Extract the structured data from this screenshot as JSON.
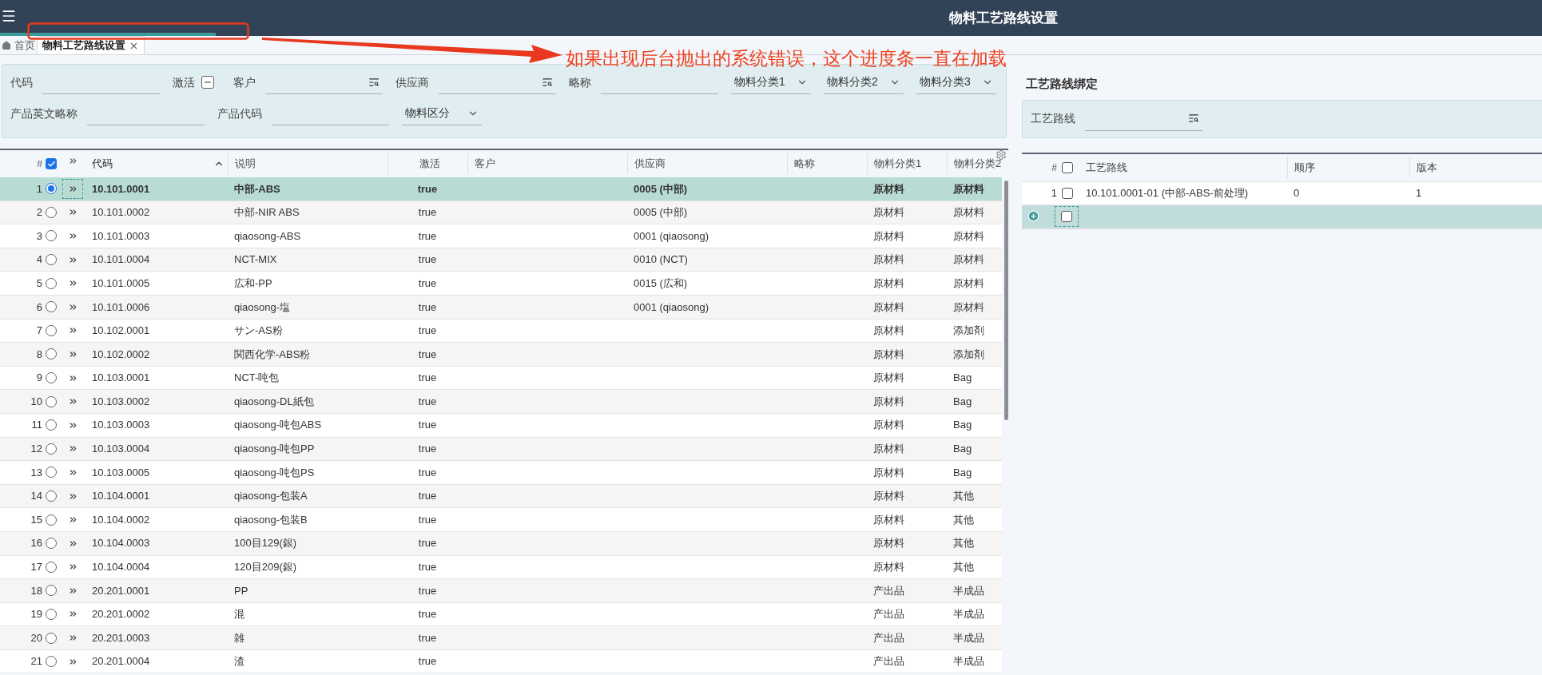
{
  "header": {
    "title": "物料工艺路线设置"
  },
  "progress": {
    "level": 0.14
  },
  "tabs": [
    {
      "label": "首页",
      "selected": false,
      "kind": "home"
    },
    {
      "label": "物料工艺路线设置",
      "selected": true,
      "kind": "closable"
    }
  ],
  "annotation": {
    "text": "如果出现后台抛出的系统错误，这个进度条一直在加载"
  },
  "filters": [
    [
      {
        "kind": "text",
        "label": "代码"
      },
      {
        "kind": "checkbox",
        "label": "激活",
        "indeterminate": true
      },
      {
        "kind": "lookup",
        "label": "客户"
      },
      {
        "kind": "lookup",
        "label": "供应商"
      },
      {
        "kind": "text",
        "label": "略称"
      },
      {
        "kind": "select",
        "label": "物料分类1"
      },
      {
        "kind": "select",
        "label": "物料分类2"
      },
      {
        "kind": "select",
        "label": "物料分类3"
      }
    ],
    [
      {
        "kind": "text",
        "label": "产品英文略称"
      },
      {
        "kind": "text",
        "label": "产品代码"
      },
      {
        "kind": "select",
        "label": "物料区分"
      }
    ]
  ],
  "table": {
    "number_heading": "#",
    "all_checked": true,
    "columns": [
      {
        "label": "代码",
        "sorted": true
      },
      {
        "label": "说明",
        "sorted": false
      },
      {
        "label": "激活",
        "sorted": false
      },
      {
        "label": "客户",
        "sorted": false
      },
      {
        "label": "供应商",
        "sorted": false
      },
      {
        "label": "略称",
        "sorted": false
      },
      {
        "label": "物料分类1",
        "sorted": false
      },
      {
        "label": "物料分类2",
        "sorted": false
      }
    ],
    "rows": [
      {
        "no": "1",
        "selected": true,
        "code": "10.101.0001",
        "description": "中部-ABS",
        "active": "true",
        "supplier": "0005 (中部)",
        "category_1": "原材料",
        "category_2": "原材料"
      },
      {
        "no": "2",
        "selected": false,
        "code": "10.101.0002",
        "description": "中部-NIR ABS",
        "active": "true",
        "supplier": "0005 (中部)",
        "category_1": "原材料",
        "category_2": "原材料"
      },
      {
        "no": "3",
        "selected": false,
        "code": "10.101.0003",
        "description": "qiaosong-ABS",
        "active": "true",
        "supplier": "0001 (qiaosong)",
        "category_1": "原材料",
        "category_2": "原材料"
      },
      {
        "no": "4",
        "selected": false,
        "code": "10.101.0004",
        "description": "NCT-MIX",
        "active": "true",
        "supplier": "0010 (NCT)",
        "category_1": "原材料",
        "category_2": "原材料"
      },
      {
        "no": "5",
        "selected": false,
        "code": "10.101.0005",
        "description": "広和-PP",
        "active": "true",
        "supplier": "0015 (広和)",
        "category_1": "原材料",
        "category_2": "原材料"
      },
      {
        "no": "6",
        "selected": false,
        "code": "10.101.0006",
        "description": "qiaosong-塩",
        "active": "true",
        "supplier": "0001 (qiaosong)",
        "category_1": "原材料",
        "category_2": "原材料"
      },
      {
        "no": "7",
        "selected": false,
        "code": "10.102.0001",
        "description": "サン-AS粉",
        "active": "true",
        "category_1": "原材料",
        "category_2": "添加剤"
      },
      {
        "no": "8",
        "selected": false,
        "code": "10.102.0002",
        "description": "関西化学-ABS粉",
        "active": "true",
        "category_1": "原材料",
        "category_2": "添加剤"
      },
      {
        "no": "9",
        "selected": false,
        "code": "10.103.0001",
        "description": "NCT-吨包",
        "active": "true",
        "category_1": "原材料",
        "category_2": "Bag"
      },
      {
        "no": "10",
        "selected": false,
        "code": "10.103.0002",
        "description": "qiaosong-DL紙包",
        "active": "true",
        "category_1": "原材料",
        "category_2": "Bag"
      },
      {
        "no": "11",
        "selected": false,
        "code": "10.103.0003",
        "description": "qiaosong-吨包ABS",
        "active": "true",
        "category_1": "原材料",
        "category_2": "Bag"
      },
      {
        "no": "12",
        "selected": false,
        "code": "10.103.0004",
        "description": "qiaosong-吨包PP",
        "active": "true",
        "category_1": "原材料",
        "category_2": "Bag"
      },
      {
        "no": "13",
        "selected": false,
        "code": "10.103.0005",
        "description": "qiaosong-吨包PS",
        "active": "true",
        "category_1": "原材料",
        "category_2": "Bag"
      },
      {
        "no": "14",
        "selected": false,
        "code": "10.104.0001",
        "description": "qiaosong-包装A",
        "active": "true",
        "category_1": "原材料",
        "category_2": "其他"
      },
      {
        "no": "15",
        "selected": false,
        "code": "10.104.0002",
        "description": "qiaosong-包装B",
        "active": "true",
        "category_1": "原材料",
        "category_2": "其他"
      },
      {
        "no": "16",
        "selected": false,
        "code": "10.104.0003",
        "description": "100目129(銀)",
        "active": "true",
        "category_1": "原材料",
        "category_2": "其他"
      },
      {
        "no": "17",
        "selected": false,
        "code": "10.104.0004",
        "description": "120目209(銀)",
        "active": "true",
        "category_1": "原材料",
        "category_2": "其他"
      },
      {
        "no": "18",
        "selected": false,
        "code": "20.201.0001",
        "description": "PP",
        "active": "true",
        "category_1": "产出品",
        "category_2": "半成品"
      },
      {
        "no": "19",
        "selected": false,
        "code": "20.201.0002",
        "description": "混",
        "active": "true",
        "category_1": "产出品",
        "category_2": "半成品"
      },
      {
        "no": "20",
        "selected": false,
        "code": "20.201.0003",
        "description": "雑",
        "active": "true",
        "category_1": "产出品",
        "category_2": "半成品"
      },
      {
        "no": "21",
        "selected": false,
        "code": "20.201.0004",
        "description": "渣",
        "active": "true",
        "category_1": "产出品",
        "category_2": "半成品"
      }
    ]
  },
  "binding": {
    "title": "工艺路线绑定",
    "filter": {
      "label": "工艺路线"
    },
    "table": {
      "number_heading": "#",
      "all_checked": false,
      "columns": [
        "工艺路线",
        "顺序",
        "版本"
      ],
      "rows": [
        {
          "no": "1",
          "checked": false,
          "route": "10.101.0001-01 (中部-ABS-前处理)",
          "order": "0",
          "version": "1"
        }
      ],
      "new_row": {
        "checked": false
      }
    }
  }
}
